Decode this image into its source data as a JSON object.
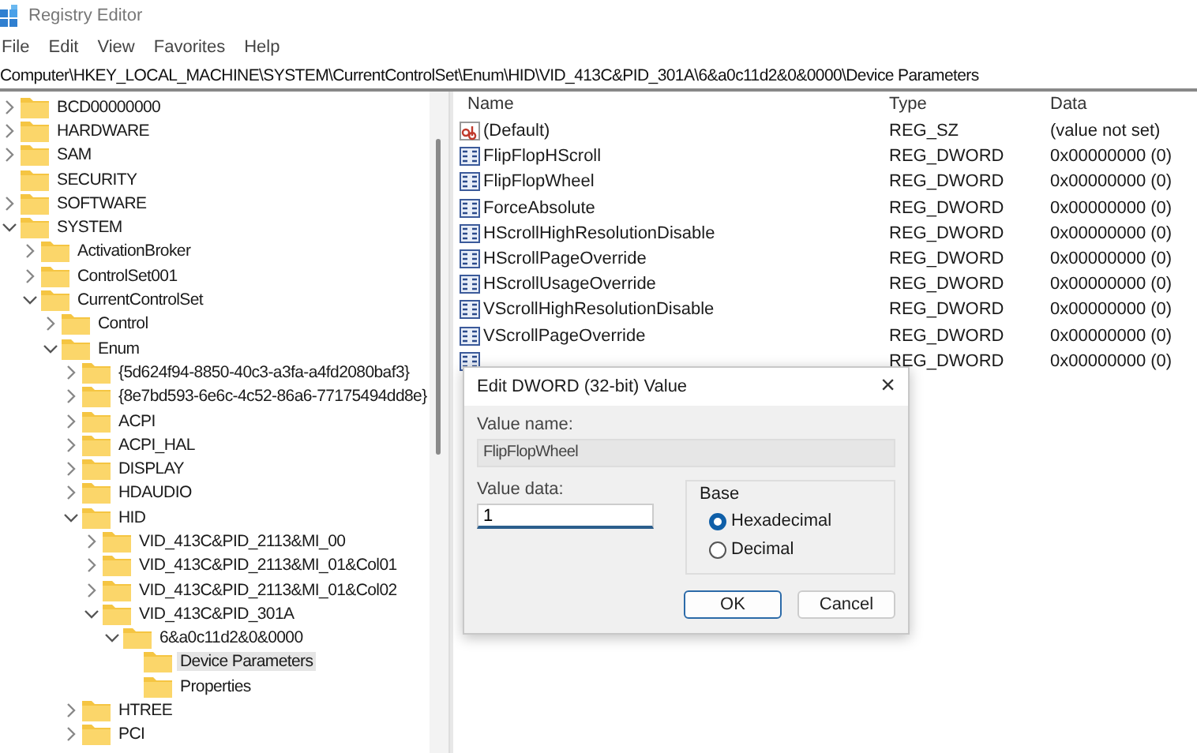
{
  "window": {
    "title": "Registry Editor"
  },
  "menu": [
    "File",
    "Edit",
    "View",
    "Favorites",
    "Help"
  ],
  "address": "Computer\\HKEY_LOCAL_MACHINE\\SYSTEM\\CurrentControlSet\\Enum\\HID\\VID_413C&PID_301A\\6&a0c11d2&0&0000\\Device Parameters",
  "tree": [
    {
      "label": "BCD00000000",
      "expanded": false,
      "selected": false
    },
    {
      "label": "HARDWARE",
      "expanded": false,
      "selected": false
    },
    {
      "label": "SAM",
      "expanded": false,
      "selected": false
    },
    {
      "label": "SECURITY",
      "selected": false
    },
    {
      "label": "SOFTWARE",
      "expanded": false,
      "selected": false
    },
    {
      "label": "SYSTEM",
      "expanded": true,
      "selected": false,
      "children": [
        {
          "label": "ActivationBroker",
          "expanded": false,
          "selected": false
        },
        {
          "label": "ControlSet001",
          "expanded": false,
          "selected": false
        },
        {
          "label": "CurrentControlSet",
          "expanded": true,
          "selected": false,
          "children": [
            {
              "label": "Control",
              "expanded": false,
              "selected": false
            },
            {
              "label": "Enum",
              "expanded": true,
              "selected": false,
              "children": [
                {
                  "label": "{5d624f94-8850-40c3-a3fa-a4fd2080baf3}",
                  "expanded": false,
                  "selected": false
                },
                {
                  "label": "{8e7bd593-6e6c-4c52-86a6-77175494dd8e}",
                  "expanded": false,
                  "selected": false
                },
                {
                  "label": "ACPI",
                  "expanded": false,
                  "selected": false
                },
                {
                  "label": "ACPI_HAL",
                  "expanded": false,
                  "selected": false
                },
                {
                  "label": "DISPLAY",
                  "expanded": false,
                  "selected": false
                },
                {
                  "label": "HDAUDIO",
                  "expanded": false,
                  "selected": false
                },
                {
                  "label": "HID",
                  "expanded": true,
                  "selected": false,
                  "children": [
                    {
                      "label": "VID_413C&PID_2113&MI_00",
                      "expanded": false,
                      "selected": false
                    },
                    {
                      "label": "VID_413C&PID_2113&MI_01&Col01",
                      "expanded": false,
                      "selected": false
                    },
                    {
                      "label": "VID_413C&PID_2113&MI_01&Col02",
                      "expanded": false,
                      "selected": false
                    },
                    {
                      "label": "VID_413C&PID_301A",
                      "expanded": true,
                      "selected": false,
                      "children": [
                        {
                          "label": "6&a0c11d2&0&0000",
                          "expanded": true,
                          "selected": false,
                          "children": [
                            {
                              "label": "Device Parameters",
                              "selected": true
                            },
                            {
                              "label": "Properties",
                              "selected": false
                            }
                          ]
                        }
                      ]
                    }
                  ]
                },
                {
                  "label": "HTREE",
                  "expanded": false,
                  "selected": false
                },
                {
                  "label": "PCI",
                  "expanded": false,
                  "selected": false
                }
              ]
            }
          ]
        }
      ]
    }
  ],
  "values": {
    "columns": [
      "Name",
      "Type",
      "Data"
    ],
    "rows": [
      {
        "kind": "string",
        "name": "(Default)",
        "type": "REG_SZ",
        "data": "(value not set)"
      },
      {
        "kind": "dword",
        "name": "FlipFlopHScroll",
        "type": "REG_DWORD",
        "data": "0x00000000 (0)"
      },
      {
        "kind": "dword",
        "name": "FlipFlopWheel",
        "type": "REG_DWORD",
        "data": "0x00000000 (0)"
      },
      {
        "kind": "dword",
        "name": "ForceAbsolute",
        "type": "REG_DWORD",
        "data": "0x00000000 (0)"
      },
      {
        "kind": "dword",
        "name": "HScrollHighResolutionDisable",
        "type": "REG_DWORD",
        "data": "0x00000000 (0)"
      },
      {
        "kind": "dword",
        "name": "HScrollPageOverride",
        "type": "REG_DWORD",
        "data": "0x00000000 (0)"
      },
      {
        "kind": "dword",
        "name": "HScrollUsageOverride",
        "type": "REG_DWORD",
        "data": "0x00000000 (0)"
      },
      {
        "kind": "dword",
        "name": "VScrollHighResolutionDisable",
        "type": "REG_DWORD",
        "data": "0x00000000 (0)"
      },
      {
        "kind": "dword",
        "name": "VScrollPageOverride",
        "type": "REG_DWORD",
        "data": "0x00000000 (0)"
      },
      {
        "kind": "dword",
        "type": "REG_DWORD",
        "data": "0x00000000 (0)"
      }
    ]
  },
  "dialog": {
    "title": "Edit DWORD (32-bit) Value",
    "close": "×",
    "value_name_label": "Value name:",
    "value_name": "FlipFlopWheel",
    "value_data_label": "Value data:",
    "value_data": "1",
    "base_label": "Base",
    "base_options": [
      {
        "label": "Hexadecimal",
        "selected": true
      },
      {
        "label": "Decimal",
        "selected": false
      }
    ],
    "buttons": [
      {
        "label": "OK",
        "default": true
      },
      {
        "label": "Cancel",
        "default": false
      }
    ]
  }
}
